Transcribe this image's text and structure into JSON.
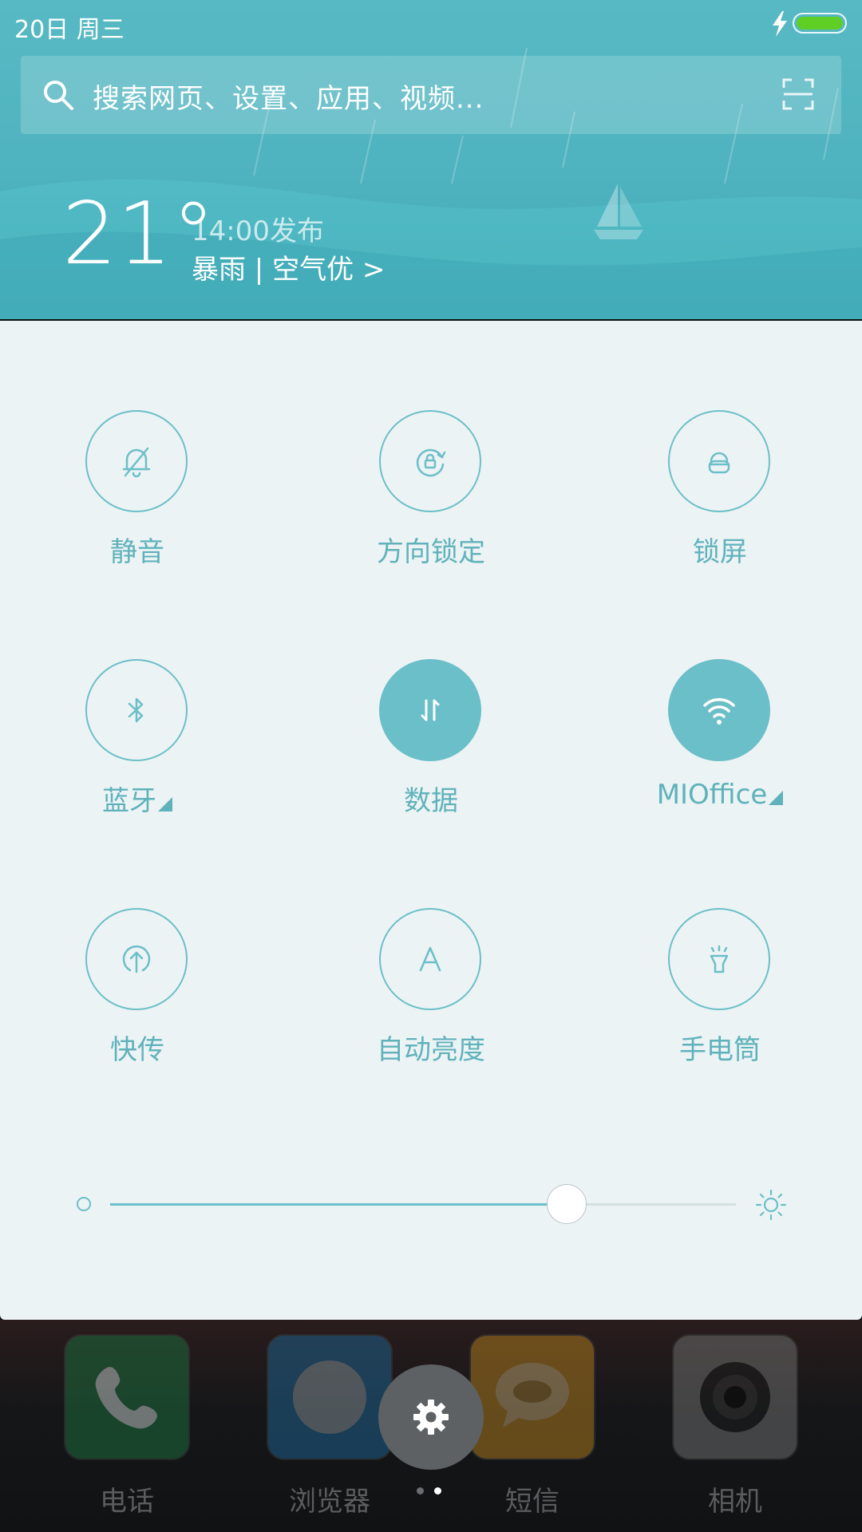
{
  "status_bar": {
    "date_text": "20日  周三"
  },
  "search": {
    "placeholder": "搜索网页、设置、应用、视频..."
  },
  "weather": {
    "temperature": "21°",
    "publish_time": "14:00发布",
    "condition": "暴雨 | 空气优 >"
  },
  "toggles": [
    {
      "label": "静音",
      "icon": "bell-off-icon",
      "active": false
    },
    {
      "label": "方向锁定",
      "icon": "rotation-lock-icon",
      "active": false
    },
    {
      "label": "锁屏",
      "icon": "lock-icon",
      "active": false
    },
    {
      "label": "蓝牙",
      "icon": "bluetooth-icon",
      "active": false
    },
    {
      "label": "数据",
      "icon": "mobile-data-icon",
      "active": true
    },
    {
      "label": "MIOffice",
      "icon": "wifi-icon",
      "active": true
    },
    {
      "label": "快传",
      "icon": "upload-icon",
      "active": false
    },
    {
      "label": "自动亮度",
      "icon": "auto-brightness-icon",
      "active": false
    },
    {
      "label": "手电筒",
      "icon": "flashlight-icon",
      "active": false
    }
  ],
  "brightness": {
    "level": 0.73
  },
  "dock": {
    "apps": [
      {
        "label": "电话",
        "icon": "phone-icon",
        "color": "#1d6b3c"
      },
      {
        "label": "浏览器",
        "icon": "browser-icon",
        "color": "#1f5f8a"
      },
      {
        "label": "短信",
        "icon": "message-icon",
        "color": "#a8771e"
      },
      {
        "label": "相机",
        "icon": "camera-icon",
        "color": "#6b6b6b"
      }
    ]
  },
  "colors": {
    "accent": "#6bbfc8",
    "header": "#4fb3bf",
    "panel": "#ecf3f4",
    "battery": "#5fcf26"
  }
}
